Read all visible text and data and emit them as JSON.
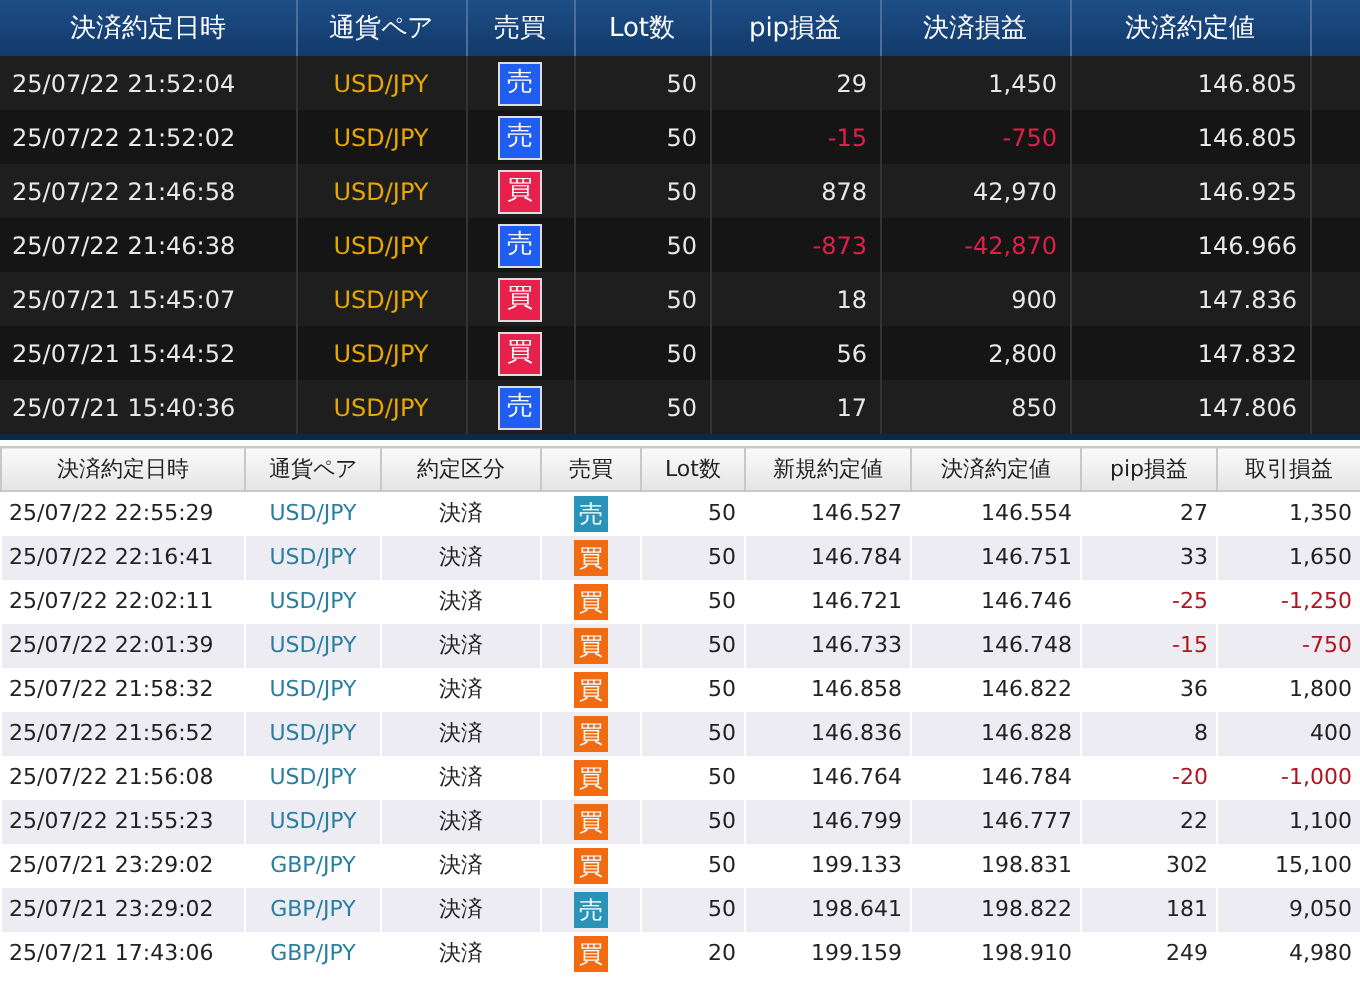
{
  "top_table": {
    "columns": [
      "決済約定日時",
      "通貨ペア",
      "売買",
      "Lot数",
      "pip損益",
      "決済損益",
      "決済約定値"
    ],
    "rows": [
      {
        "time": "25/07/22 21:52:04",
        "pair": "USD/JPY",
        "kind": "sell",
        "side_label": "売",
        "lot": "50",
        "pips": "29",
        "pnl": "1,450",
        "price": "146.805",
        "loss": false
      },
      {
        "time": "25/07/22 21:52:02",
        "pair": "USD/JPY",
        "kind": "sell",
        "side_label": "売",
        "lot": "50",
        "pips": "-15",
        "pnl": "-750",
        "price": "146.805",
        "loss": true
      },
      {
        "time": "25/07/22 21:46:58",
        "pair": "USD/JPY",
        "kind": "buy",
        "side_label": "買",
        "lot": "50",
        "pips": "878",
        "pnl": "42,970",
        "price": "146.925",
        "loss": false
      },
      {
        "time": "25/07/22 21:46:38",
        "pair": "USD/JPY",
        "kind": "sell",
        "side_label": "売",
        "lot": "50",
        "pips": "-873",
        "pnl": "-42,870",
        "price": "146.966",
        "loss": true
      },
      {
        "time": "25/07/21 15:45:07",
        "pair": "USD/JPY",
        "kind": "buy",
        "side_label": "買",
        "lot": "50",
        "pips": "18",
        "pnl": "900",
        "price": "147.836",
        "loss": false
      },
      {
        "time": "25/07/21 15:44:52",
        "pair": "USD/JPY",
        "kind": "buy",
        "side_label": "買",
        "lot": "50",
        "pips": "56",
        "pnl": "2,800",
        "price": "147.832",
        "loss": false
      },
      {
        "time": "25/07/21 15:40:36",
        "pair": "USD/JPY",
        "kind": "sell",
        "side_label": "売",
        "lot": "50",
        "pips": "17",
        "pnl": "850",
        "price": "147.806",
        "loss": false
      }
    ]
  },
  "bottom_table": {
    "columns": [
      "決済約定日時",
      "通貨ペア",
      "約定区分",
      "売買",
      "Lot数",
      "新規約定値",
      "決済約定値",
      "pip損益",
      "取引損益"
    ],
    "rows": [
      {
        "time": "25/07/22 22:55:29",
        "pair": "USD/JPY",
        "type": "決済",
        "kind": "sell",
        "side_label": "売",
        "lot": "50",
        "open": "146.527",
        "close": "146.554",
        "pips": "27",
        "pnl": "1,350",
        "loss": false
      },
      {
        "time": "25/07/22 22:16:41",
        "pair": "USD/JPY",
        "type": "決済",
        "kind": "buy",
        "side_label": "買",
        "lot": "50",
        "open": "146.784",
        "close": "146.751",
        "pips": "33",
        "pnl": "1,650",
        "loss": false
      },
      {
        "time": "25/07/22 22:02:11",
        "pair": "USD/JPY",
        "type": "決済",
        "kind": "buy",
        "side_label": "買",
        "lot": "50",
        "open": "146.721",
        "close": "146.746",
        "pips": "-25",
        "pnl": "-1,250",
        "loss": true
      },
      {
        "time": "25/07/22 22:01:39",
        "pair": "USD/JPY",
        "type": "決済",
        "kind": "buy",
        "side_label": "買",
        "lot": "50",
        "open": "146.733",
        "close": "146.748",
        "pips": "-15",
        "pnl": "-750",
        "loss": true
      },
      {
        "time": "25/07/22 21:58:32",
        "pair": "USD/JPY",
        "type": "決済",
        "kind": "buy",
        "side_label": "買",
        "lot": "50",
        "open": "146.858",
        "close": "146.822",
        "pips": "36",
        "pnl": "1,800",
        "loss": false
      },
      {
        "time": "25/07/22 21:56:52",
        "pair": "USD/JPY",
        "type": "決済",
        "kind": "buy",
        "side_label": "買",
        "lot": "50",
        "open": "146.836",
        "close": "146.828",
        "pips": "8",
        "pnl": "400",
        "loss": false
      },
      {
        "time": "25/07/22 21:56:08",
        "pair": "USD/JPY",
        "type": "決済",
        "kind": "buy",
        "side_label": "買",
        "lot": "50",
        "open": "146.764",
        "close": "146.784",
        "pips": "-20",
        "pnl": "-1,000",
        "loss": true
      },
      {
        "time": "25/07/22 21:55:23",
        "pair": "USD/JPY",
        "type": "決済",
        "kind": "buy",
        "side_label": "買",
        "lot": "50",
        "open": "146.799",
        "close": "146.777",
        "pips": "22",
        "pnl": "1,100",
        "loss": false
      },
      {
        "time": "25/07/21 23:29:02",
        "pair": "GBP/JPY",
        "type": "決済",
        "kind": "buy",
        "side_label": "買",
        "lot": "50",
        "open": "199.133",
        "close": "198.831",
        "pips": "302",
        "pnl": "15,100",
        "loss": false
      },
      {
        "time": "25/07/21 23:29:02",
        "pair": "GBP/JPY",
        "type": "決済",
        "kind": "sell",
        "side_label": "売",
        "lot": "50",
        "open": "198.641",
        "close": "198.822",
        "pips": "181",
        "pnl": "9,050",
        "loss": false
      },
      {
        "time": "25/07/21 17:43:06",
        "pair": "GBP/JPY",
        "type": "決済",
        "kind": "buy",
        "side_label": "買",
        "lot": "20",
        "open": "199.159",
        "close": "198.910",
        "pips": "249",
        "pnl": "4,980",
        "loss": false
      }
    ]
  }
}
